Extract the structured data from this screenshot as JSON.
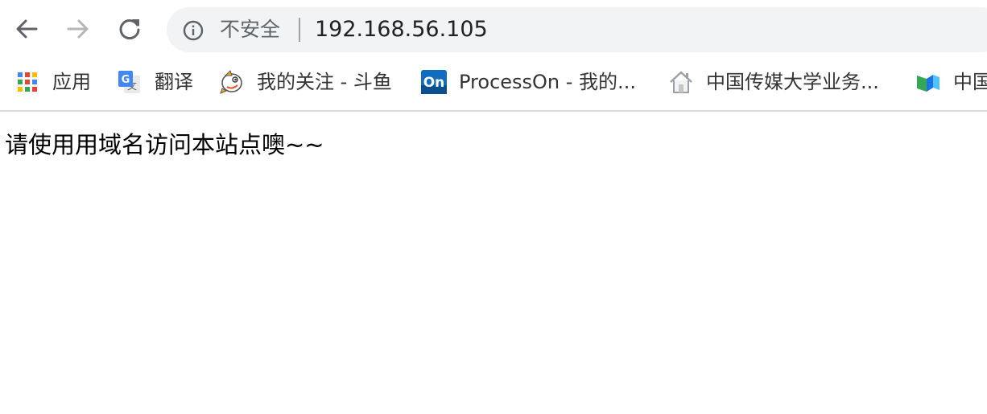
{
  "toolbar": {
    "back_icon": "arrow-left-icon",
    "forward_icon": "arrow-right-icon",
    "reload_icon": "reload-icon"
  },
  "omnibox": {
    "security_icon": "info-icon",
    "security_label": "不安全",
    "url": "192.168.56.105"
  },
  "bookmarks": [
    {
      "label": "应用",
      "icon": "apps-grid-icon"
    },
    {
      "label": "翻译",
      "icon": "google-translate-icon"
    },
    {
      "label": "我的关注 - 斗鱼",
      "icon": "douyu-fish-icon"
    },
    {
      "label": "ProcessOn - 我的...",
      "icon": "processon-icon"
    },
    {
      "label": "中国传媒大学业务...",
      "icon": "house-icon"
    },
    {
      "label": "中国",
      "icon": "bookmark-logo-icon"
    }
  ],
  "colors": {
    "apps_grid": [
      "#4285f4",
      "#ea4335",
      "#fbbc05",
      "#34a853",
      "#ea4335",
      "#4285f4",
      "#fbbc05",
      "#34a853",
      "#ea4335"
    ]
  },
  "page": {
    "message": "请使用用域名访问本站点噢~~"
  }
}
